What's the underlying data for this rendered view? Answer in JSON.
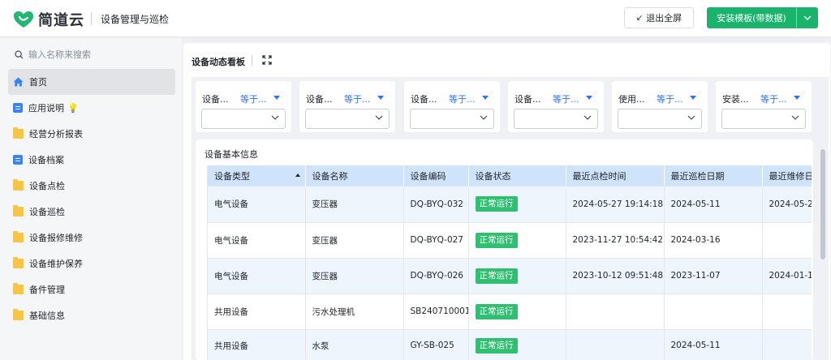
{
  "header": {
    "logo_text": "简道云",
    "app_title": "设备管理与巡检",
    "exit_fullscreen_label": "退出全屏",
    "install_label": "安装模板(带数据)"
  },
  "sidebar": {
    "search_placeholder": "输入名称来搜索",
    "items": [
      {
        "label": "首页",
        "icon": "home-icon",
        "active": true
      },
      {
        "label": "应用说明",
        "icon": "doc-icon"
      },
      {
        "label": "经营分析报表",
        "icon": "folder-icon"
      },
      {
        "label": "设备档案",
        "icon": "doc-icon"
      },
      {
        "label": "设备点检",
        "icon": "folder-icon"
      },
      {
        "label": "设备巡检",
        "icon": "folder-icon"
      },
      {
        "label": "设备报修维修",
        "icon": "folder-icon"
      },
      {
        "label": "设备维护保养",
        "icon": "folder-icon"
      },
      {
        "label": "备件管理",
        "icon": "folder-icon"
      },
      {
        "label": "基础信息",
        "icon": "folder-icon"
      }
    ]
  },
  "board": {
    "title": "设备动态看板",
    "filters": [
      {
        "field": "设备...",
        "op": "等于..."
      },
      {
        "field": "设备...",
        "op": "等于..."
      },
      {
        "field": "设备...",
        "op": "等于..."
      },
      {
        "field": "设备...",
        "op": "等于..."
      },
      {
        "field": "使用...",
        "op": "等于..."
      },
      {
        "field": "安装...",
        "op": "等于..."
      }
    ],
    "table_title": "设备基本信息",
    "columns": [
      "设备类型",
      "设备名称",
      "设备编码",
      "设备状态",
      "最近点检时间",
      "最近巡检日期",
      "最近维修日期"
    ],
    "rows": [
      [
        "电气设备",
        "变压器",
        "DQ-BYQ-032",
        "正常运行",
        "2024-05-27 19:14:18",
        "2024-05-11",
        "2024-05-2"
      ],
      [
        "电气设备",
        "变压器",
        "DQ-BYQ-027",
        "正常运行",
        "2023-11-27 10:54:42",
        "2024-03-16",
        ""
      ],
      [
        "电气设备",
        "变压器",
        "DQ-BYQ-026",
        "正常运行",
        "2023-10-12 09:51:48",
        "2023-11-07",
        "2024-01-1"
      ],
      [
        "共用设备",
        "污水处理机",
        "SB240710001",
        "正常运行",
        "",
        "",
        ""
      ],
      [
        "共用设备",
        "水泵",
        "GY-SB-025",
        "正常运行",
        "",
        "2024-05-11",
        ""
      ]
    ]
  },
  "colors": {
    "accent_green": "#19b36b",
    "status_green": "#2fbf71",
    "link_blue": "#3370ff",
    "header_blue": "#cfe3fb"
  }
}
